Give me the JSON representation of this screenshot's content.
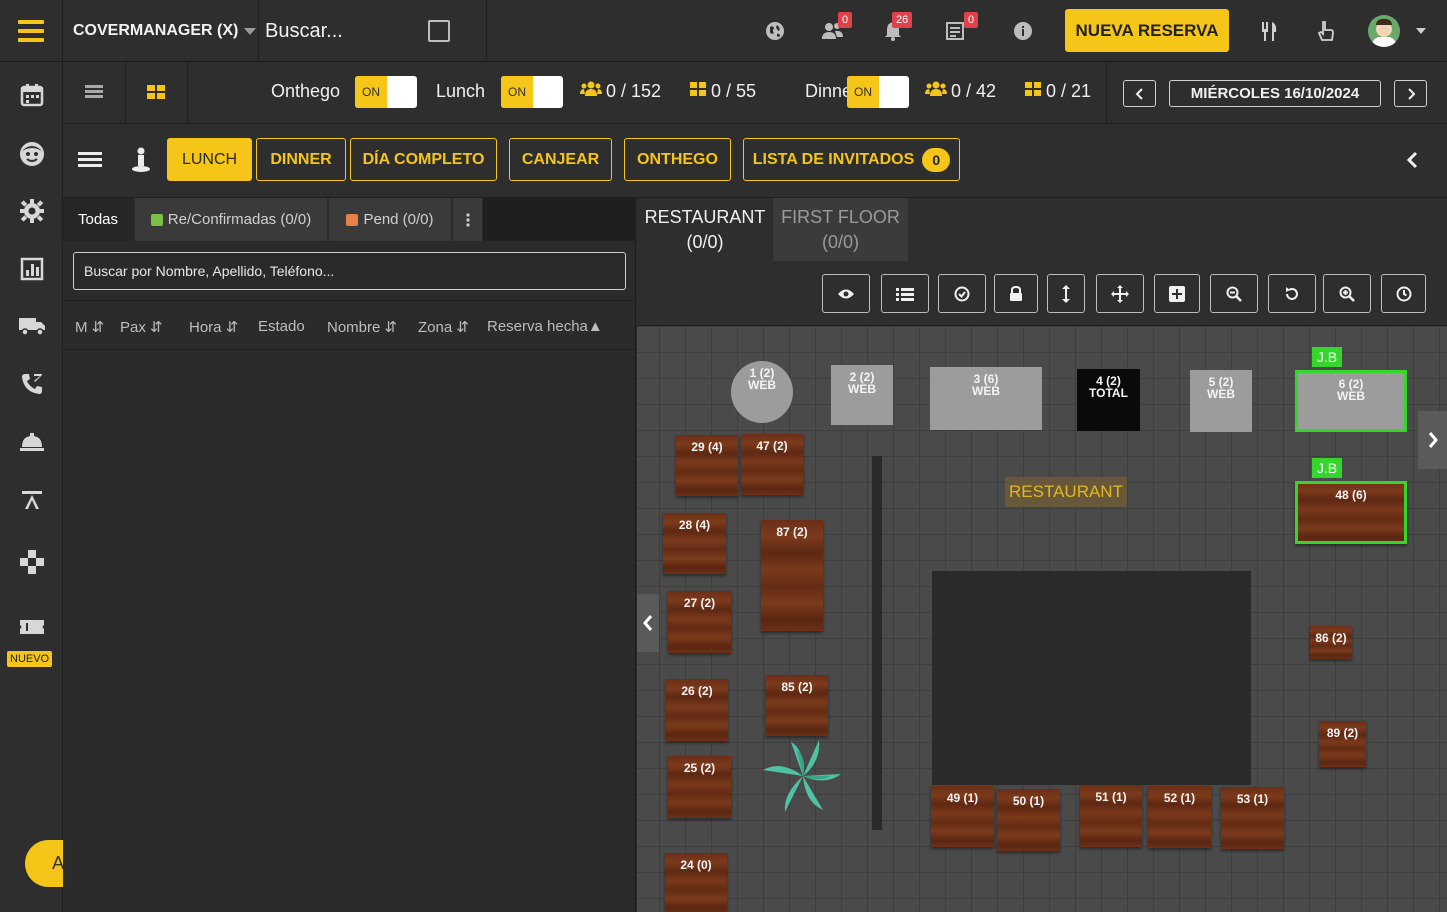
{
  "topbar": {
    "brand": "COVERMANAGER (X)",
    "search_label": "Buscar...",
    "badges": {
      "people": "0",
      "bell": "26",
      "list": "0"
    },
    "new_reservation": "NUEVA RESERVA"
  },
  "sidebar": {
    "new_badge": "NUEVO",
    "help": "Ayuda"
  },
  "services": {
    "onthego": {
      "label": "Onthego",
      "toggle": "ON"
    },
    "lunch": {
      "label": "Lunch",
      "toggle": "ON",
      "pax": "0 / 152",
      "tables": "0 / 55"
    },
    "dinner": {
      "label": "Dinner",
      "toggle": "ON",
      "pax": "0 / 42",
      "tables": "0 / 21"
    },
    "date": "MIÉRCOLES 16/10/2024"
  },
  "filters": {
    "lunch": "LUNCH",
    "dinner": "DINNER",
    "full_day": "DÍA COMPLETO",
    "redeem": "CANJEAR",
    "onthego": "ONTHEGO",
    "guest_list": "LISTA DE INVITADOS",
    "guest_count": "0"
  },
  "list": {
    "tabs": {
      "all": "Todas",
      "confirmed": "Re/Confirmadas (0/0)",
      "pending": "Pend (0/0)"
    },
    "search_placeholder": "Buscar por Nombre, Apellido, Teléfono...",
    "columns": [
      "M",
      "Pax",
      "Hora",
      "Estado",
      "Nombre",
      "Zona",
      "Reserva hecha"
    ]
  },
  "floor": {
    "tabs": [
      {
        "name": "RESTAURANT",
        "count": "(0/0)"
      },
      {
        "name": "FIRST FLOOR",
        "count": "(0/0)"
      }
    ],
    "zone_label": "RESTAURANT",
    "tags": {
      "t6": "J.B",
      "t48": "J.B"
    },
    "tables": {
      "t1": {
        "label": "1 (2)",
        "sub": "WEB"
      },
      "t2": {
        "label": "2 (2)",
        "sub": "WEB"
      },
      "t3": {
        "label": "3 (6)",
        "sub": "WEB"
      },
      "t4": {
        "label": "4 (2)",
        "sub": "TOTAL"
      },
      "t5": {
        "label": "5 (2)",
        "sub": "WEB"
      },
      "t6": {
        "label": "6 (2)",
        "sub": "WEB"
      },
      "t29": "29 (4)",
      "t47": "47 (2)",
      "t28": "28 (4)",
      "t87": "87 (2)",
      "t27": "27 (2)",
      "t26": "26 (2)",
      "t85": "85 (2)",
      "t25": "25 (2)",
      "t24": "24 (0)",
      "t48": "48 (6)",
      "t86": "86 (2)",
      "t89": "89 (2)",
      "t49": "49 (1)",
      "t50": "50 (1)",
      "t51": "51 (1)",
      "t52": "52 (1)",
      "t53": "53 (1)"
    }
  },
  "colors": {
    "accent": "#f5c518",
    "selected": "#34d62c",
    "badge": "#e0424b",
    "confirmed": "#7ac143",
    "pending": "#e8804a"
  }
}
